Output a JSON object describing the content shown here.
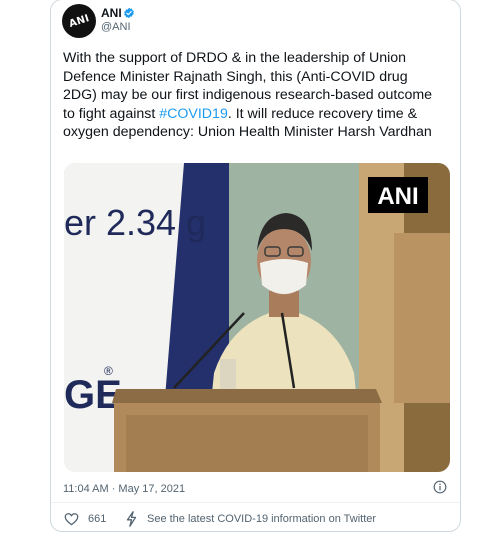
{
  "author": {
    "name": "ANI",
    "handle": "@ANI",
    "avatar_text": "ANI",
    "verified": true
  },
  "tweet": {
    "text_before": "With the support of DRDO & in the leadership of Union Defence Minister Rajnath Singh, this (Anti-COVID drug 2DG) may be our first indigenous research-based outcome to fight against ",
    "hashtag": "#COVID19",
    "text_after": ". It will reduce recovery time & oxygen dependency: Union Health Minister Harsh Vardhan",
    "timestamp": "11:04 AM · May 17, 2021"
  },
  "media": {
    "watermark": "ANI",
    "banner_text_top": "er 2.34 g",
    "banner_text_bottom": "GE"
  },
  "actions": {
    "like_count": "661",
    "covid_info": "See the latest COVID-19 information on Twitter"
  },
  "colors": {
    "link": "#1d9bf0",
    "muted": "#536471",
    "verified": "#1d9bf0"
  },
  "icons": [
    "verified-badge-icon",
    "info-icon",
    "heart-icon",
    "bolt-icon"
  ]
}
